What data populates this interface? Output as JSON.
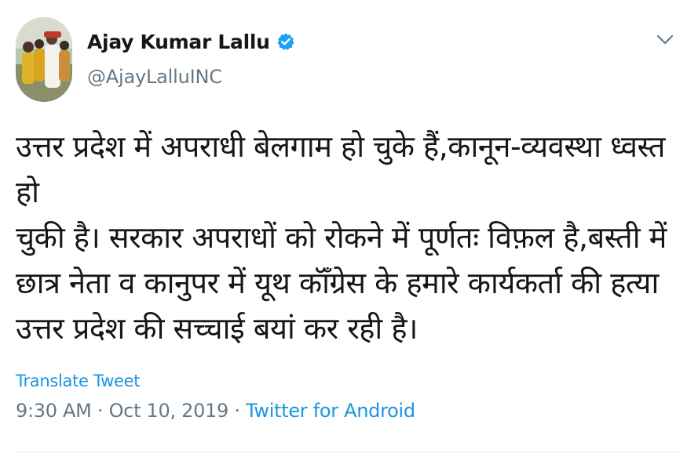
{
  "tweet": {
    "author": {
      "display_name": "Ajay Kumar Lallu",
      "handle": "@AjayLalluINC",
      "verified_icon": "verified-badge-icon",
      "avatar_icon": "profile-photo-avatar"
    },
    "menu_icon": "chevron-down-icon",
    "text": "उत्तर प्रदेश में अपराधी बेलगाम हो चुके हैं,कानून-व्यवस्था ध्वस्त हो\nचुकी है। सरकार अपराधों को रोकने में पूर्णतः विफ़ल है,बस्ती में\nछात्र नेता व कानुपर में यूथ कॉँग्रेस के हमारे कार्यकर्ता की हत्या\nउत्तर प्रदेश की सच्चाई बयां कर रही है।",
    "translate_label": "Translate Tweet",
    "time": "9:30 AM",
    "separator": "·",
    "date": "Oct 10, 2019",
    "source": "Twitter for Android"
  },
  "colors": {
    "link": "#1b95e0",
    "secondary_text": "#657786",
    "primary_text": "#14171a",
    "verified": "#1da1f2"
  }
}
